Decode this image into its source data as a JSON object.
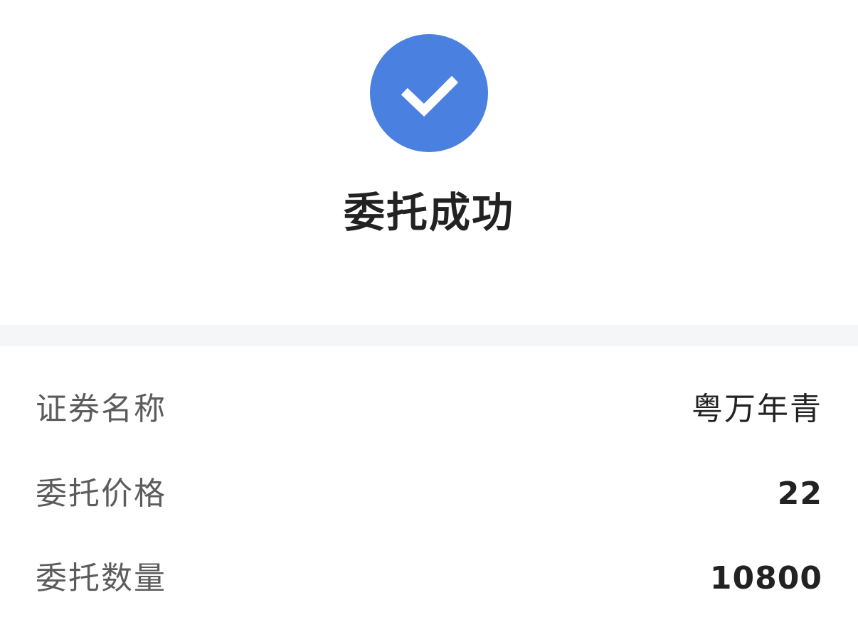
{
  "status": {
    "icon": "check-icon",
    "title": "委托成功",
    "color": "#4a80df"
  },
  "details": [
    {
      "label": "证券名称",
      "value": "粤万年青"
    },
    {
      "label": "委托价格",
      "value": "22"
    },
    {
      "label": "委托数量",
      "value": "10800"
    }
  ]
}
